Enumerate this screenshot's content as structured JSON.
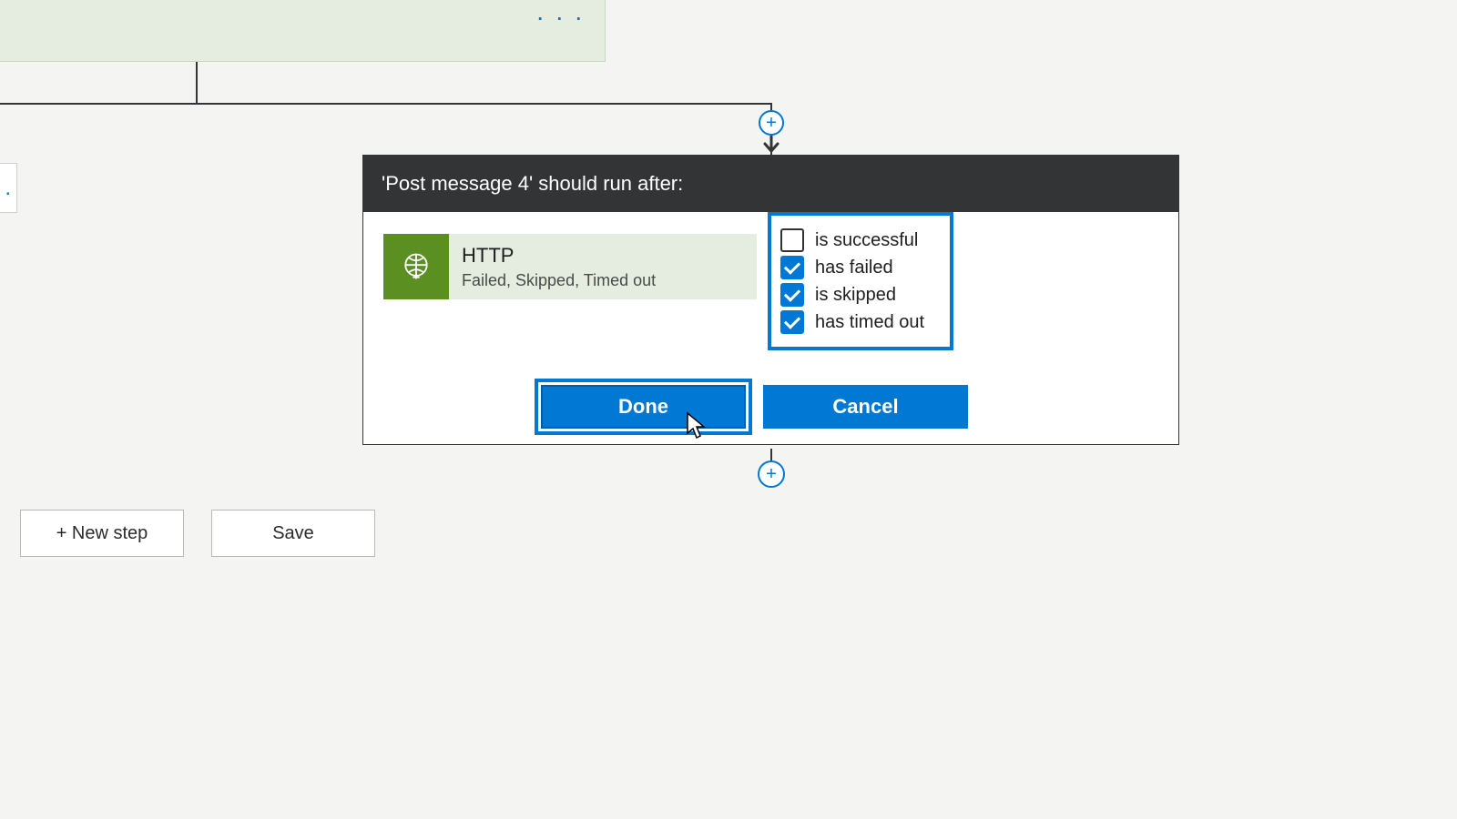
{
  "top_card": {
    "menu_glyph": "· · ·"
  },
  "side_box": {
    "glyph": ". ."
  },
  "panel": {
    "header": "'Post message 4' should run after:",
    "action": {
      "title": "HTTP",
      "subtitle": "Failed, Skipped, Timed out",
      "icon_name": "globe-icon"
    },
    "conditions": [
      {
        "label": "is successful",
        "checked": false
      },
      {
        "label": "has failed",
        "checked": true
      },
      {
        "label": "is skipped",
        "checked": true
      },
      {
        "label": "has timed out",
        "checked": true
      }
    ],
    "buttons": {
      "done": "Done",
      "cancel": "Cancel"
    }
  },
  "footer": {
    "new_step": "+ New step",
    "save": "Save"
  }
}
